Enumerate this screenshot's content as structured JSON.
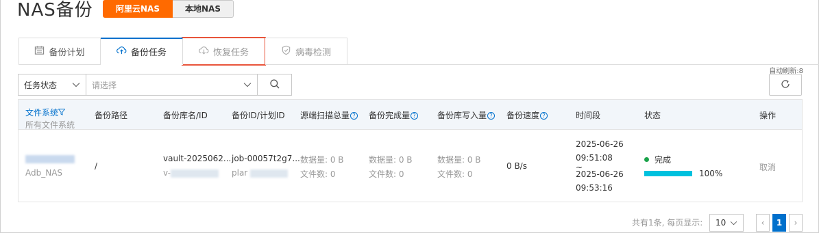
{
  "page": {
    "title": "NAS备份"
  },
  "source_toggle": {
    "options": [
      "阿里云NAS",
      "本地NAS"
    ],
    "active": 0,
    "accent": "#ff6a00"
  },
  "tabs": [
    {
      "label": "备份计划",
      "icon": "calendar-icon"
    },
    {
      "label": "备份任务",
      "icon": "cloud-upload-icon",
      "active": true
    },
    {
      "label": "恢复任务",
      "icon": "cloud-download-icon",
      "disabled": true,
      "highlighted": true
    },
    {
      "label": "病毒检测",
      "icon": "shield-icon",
      "disabled": true
    }
  ],
  "refresh": {
    "label": "自动刷新:8"
  },
  "filter": {
    "field": "任务状态",
    "placeholder": "请选择"
  },
  "table": {
    "filesystem_header": {
      "title": "文件系统",
      "subtitle": "所有文件系统"
    },
    "headers": {
      "path": "备份路径",
      "vault": "备份库名/ID",
      "backup_id": "备份ID/计划ID",
      "source_scan": "源端扫描总量",
      "completed": "备份完成量",
      "vault_write": "备份库写入量",
      "speed": "备份速度",
      "time": "时间段",
      "status": "状态",
      "action": "操作"
    },
    "row": {
      "filesystem_name": "Adb_NAS",
      "path": "/",
      "vault_name": "vault-2025062...",
      "vault_id": "v-",
      "job_id": "job-00057t2g7...",
      "plan_id": "plar",
      "source_data": "数据量:  0 B",
      "source_files": "文件数:  0",
      "done_data": "数据量:  0 B",
      "done_files": "文件数:  0",
      "write_data": "数据量:  0 B",
      "write_files": "文件数:  0",
      "speed": "0 B/s",
      "start_date": "2025-06-26",
      "start_time": "09:51:08",
      "tilde": "~",
      "end_date": "2025-06-26",
      "end_time": "09:53:16",
      "status": "完成",
      "status_color": "#1aa34a",
      "progress": 1.0,
      "progress_label": "100%",
      "progress_color": "#00c1de",
      "action": "取消"
    }
  },
  "pagination": {
    "info": "共有1条, 每页显示:",
    "page_size": "10",
    "current_page": "1"
  }
}
